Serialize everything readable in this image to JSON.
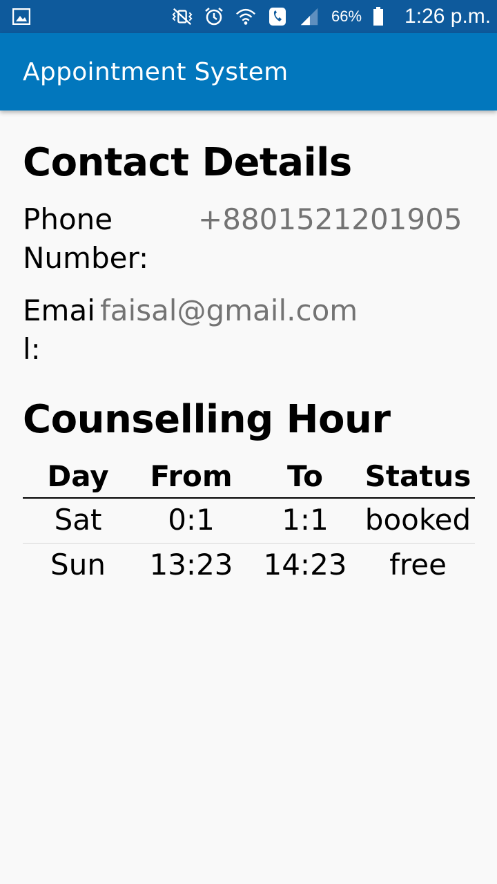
{
  "status_bar": {
    "battery_text": "66%",
    "time": "1:26 p.m.",
    "icons": [
      "gallery-icon",
      "mute-vibrate-icon",
      "alarm-icon",
      "wifi-icon",
      "call-icon",
      "signal-icon",
      "battery-icon"
    ]
  },
  "app_bar": {
    "title": "Appointment System",
    "color": "#0277bd"
  },
  "contact": {
    "heading": "Contact Details",
    "phone_label": "Phone Number:",
    "phone_value": "+8801521201905",
    "email_label": "Email:",
    "email_value": "faisal@gmail.com"
  },
  "counselling": {
    "heading": "Counselling Hour",
    "headers": [
      "Day",
      "From",
      "To",
      "Status"
    ],
    "rows": [
      [
        "Sat",
        "0:1",
        "1:1",
        "booked"
      ],
      [
        "Sun",
        "13:23",
        "14:23",
        "free"
      ]
    ]
  }
}
